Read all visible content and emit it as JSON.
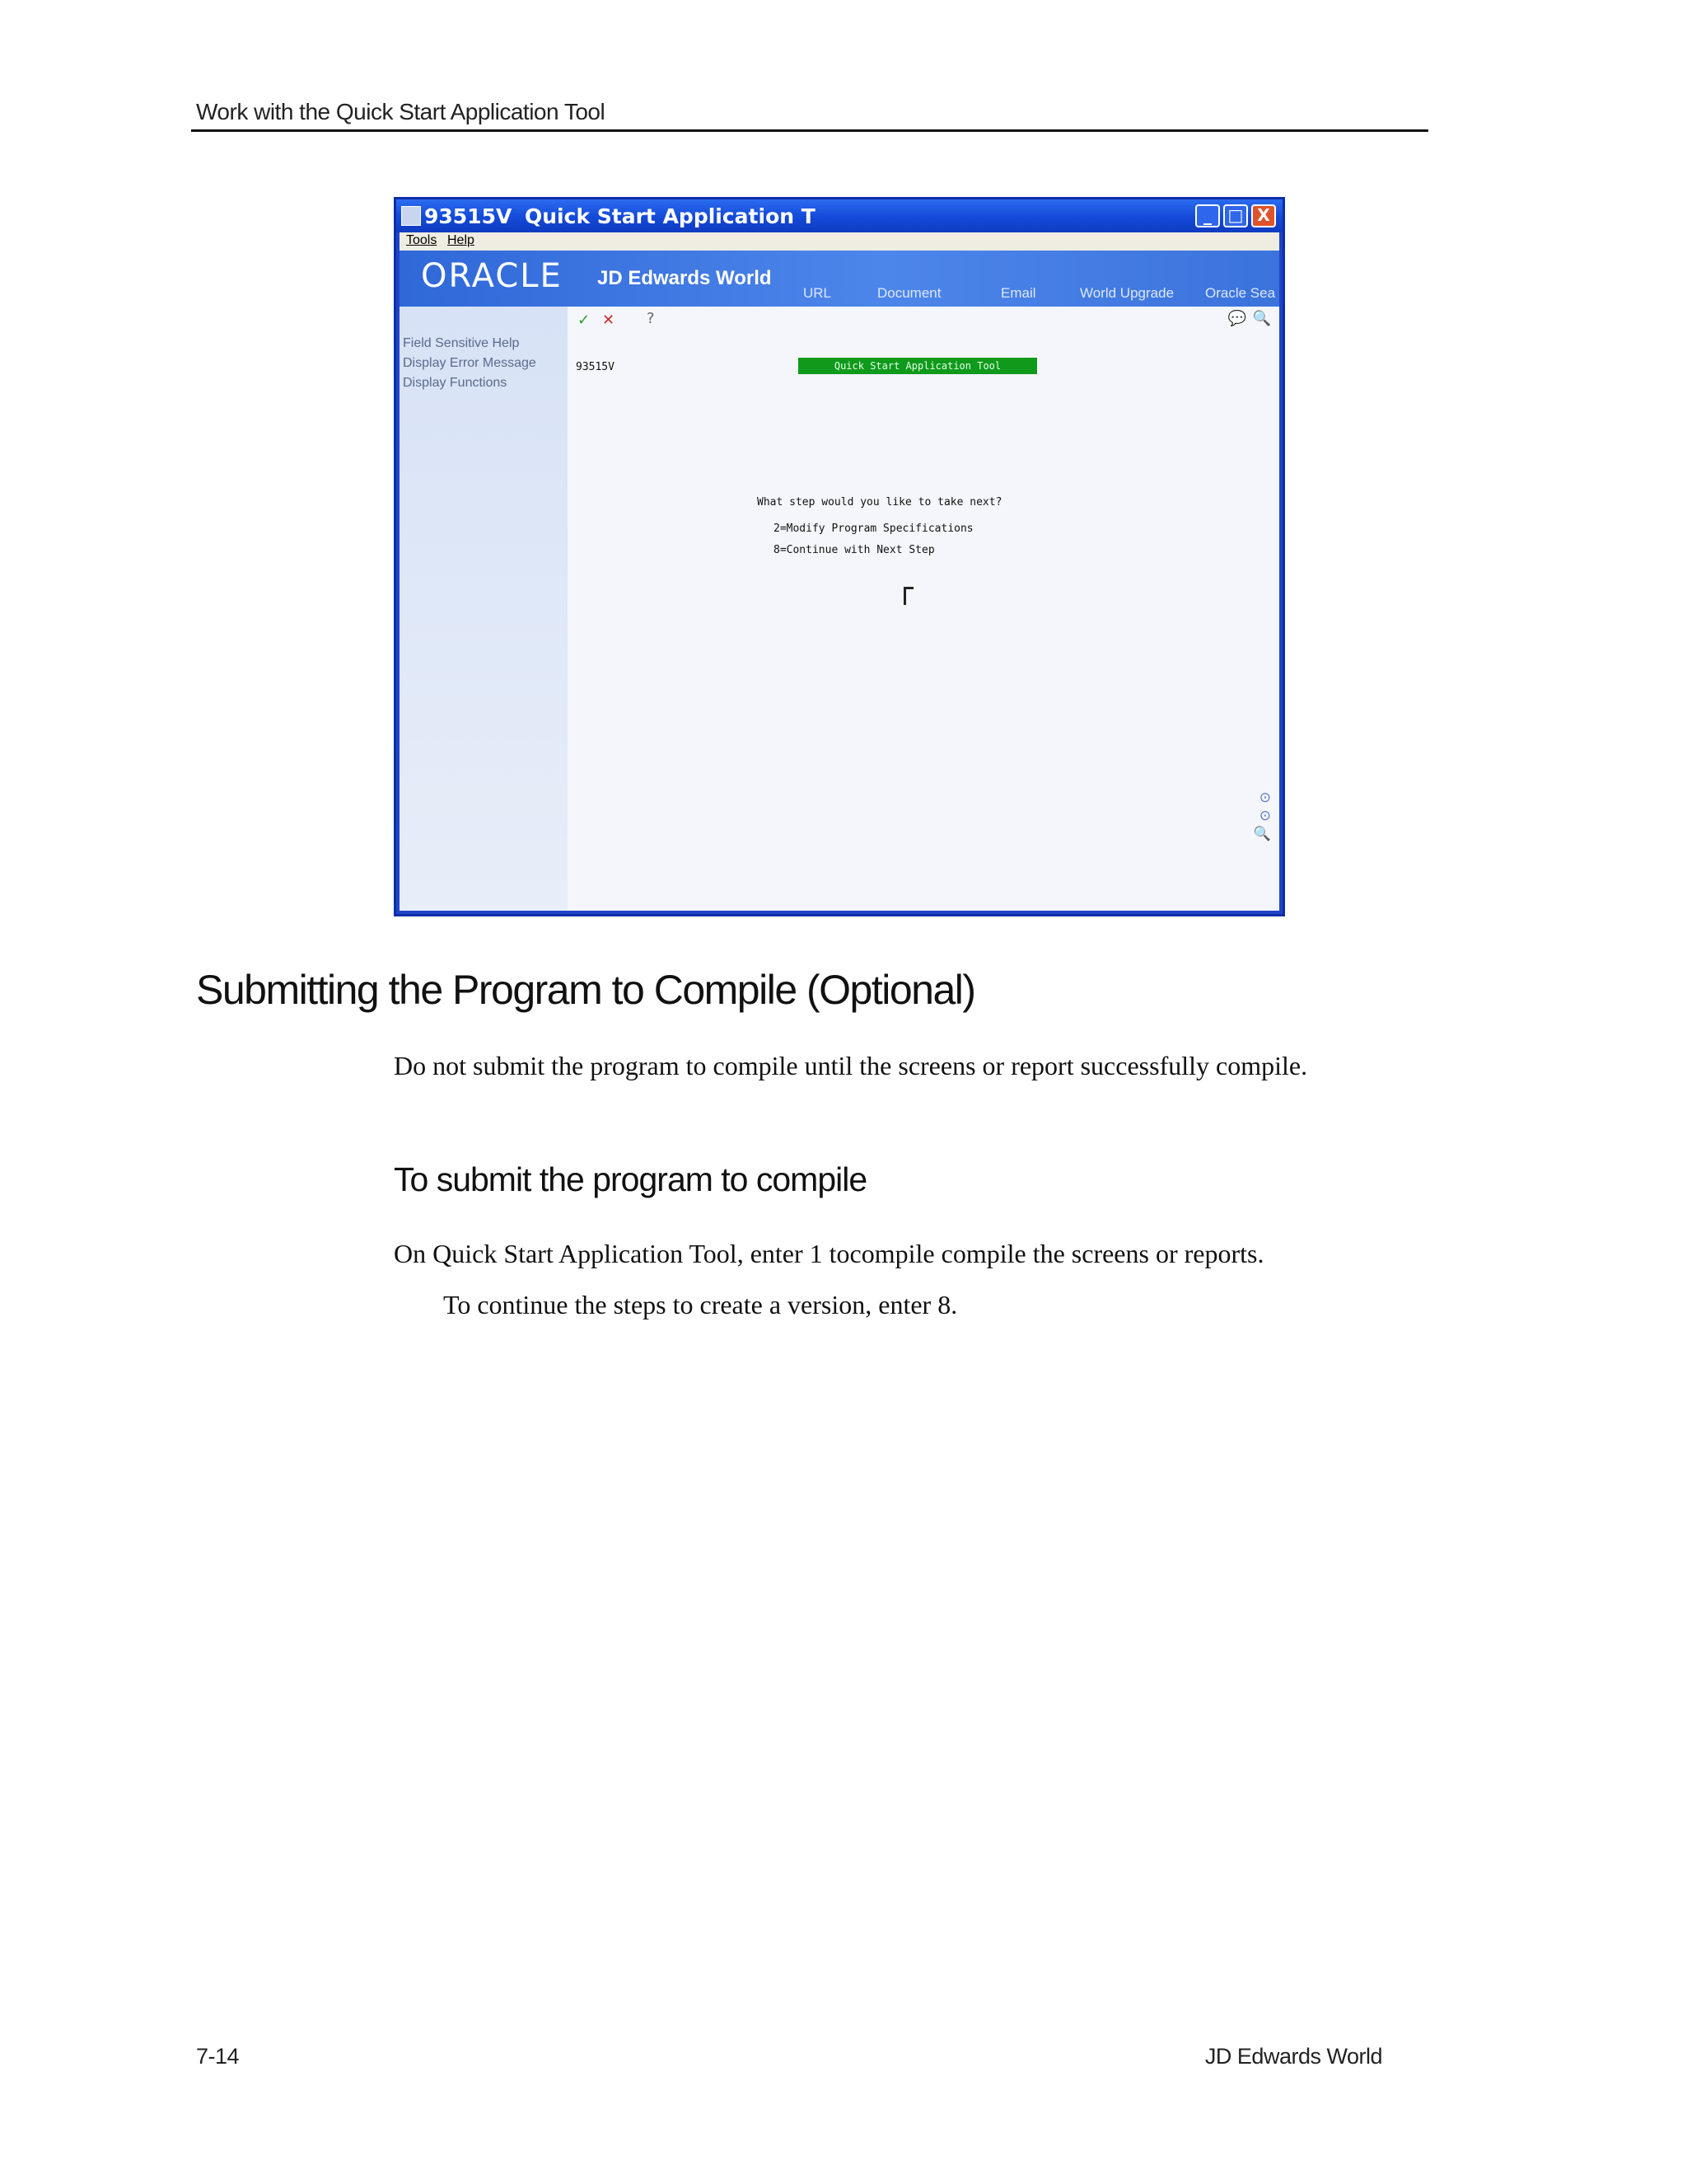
{
  "running_header": "Work with the Quick Start Application Tool",
  "screenshot": {
    "window_code": "93515V",
    "window_title": "Quick Start Application T",
    "window_buttons": [
      "_",
      "□",
      "X"
    ],
    "menu": [
      "Tools",
      "Help"
    ],
    "brand_oracle": "ORACLE",
    "brand_jde": "JD Edwards World",
    "nav_links": [
      "URL",
      "Document",
      "Email",
      "World Upgrade",
      "Oracle Sea"
    ],
    "toolbar_icons": [
      "✓",
      "✕",
      "?"
    ],
    "side_links": [
      "Field Sensitive Help",
      "Display Error Message",
      "Display Functions"
    ],
    "program_id": "93515V",
    "screen_heading": "Quick Start Application Tool",
    "prompt": "What step would you like to take next?",
    "options": [
      "2=Modify Program Specifications",
      "8=Continue with Next Step"
    ]
  },
  "section_heading": "Submitting the Program to Compile (Optional)",
  "intro": "Do not submit the program to compile until the screens or report successfully compile.",
  "procedure_heading": "To submit the program to compile",
  "step": "On Quick Start Application Tool, enter 1 tocompile compile the screens or reports.",
  "step_note": "To continue the steps to create a version, enter 8.",
  "footer": {
    "page_number": "7-14",
    "book_title": "JD Edwards World"
  }
}
